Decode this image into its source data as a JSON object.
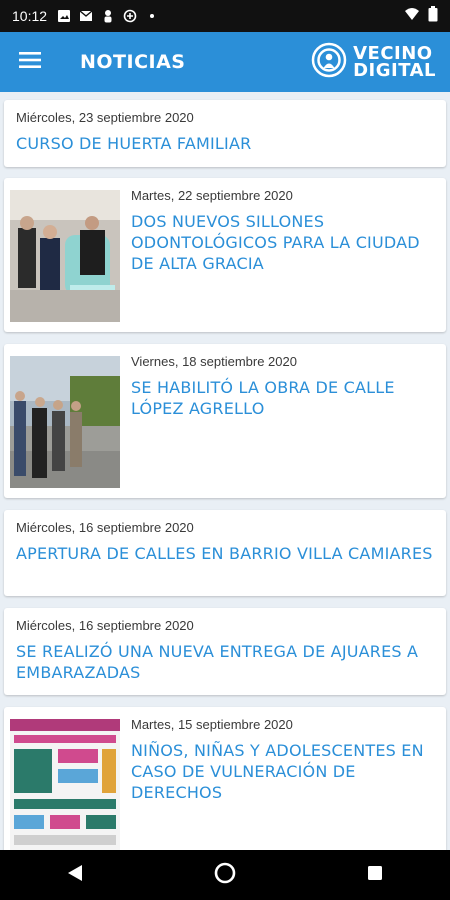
{
  "status_bar": {
    "time": "10:12"
  },
  "app_bar": {
    "title": "NOTICIAS",
    "brand_line1": "VECINO",
    "brand_line2": "DIGITAL"
  },
  "news": [
    {
      "date": "Miércoles, 23 septiembre 2020",
      "title": "CURSO DE HUERTA FAMILIAR"
    },
    {
      "date": "Martes, 22 septiembre 2020",
      "title": "DOS NUEVOS SILLONES ODONTOLÓGICOS PARA LA CIUDAD DE ALTA GRACIA"
    },
    {
      "date": "Viernes, 18 septiembre 2020",
      "title": "SE HABILITÓ LA OBRA DE CALLE LÓPEZ AGRELLO"
    },
    {
      "date": "Miércoles, 16 septiembre 2020",
      "title": "APERTURA DE CALLES EN BARRIO VILLA CAMIARES"
    },
    {
      "date": "Miércoles, 16 septiembre 2020",
      "title": "SE REALIZÓ UNA NUEVA ENTREGA DE AJUARES A EMBARAZADAS"
    },
    {
      "date": "Martes, 15 septiembre 2020",
      "title": "NIÑOS, NIÑAS Y ADOLESCENTES EN CASO DE VULNERACIÓN DE DERECHOS"
    }
  ],
  "icons": {
    "menu": "hamburger-menu-icon",
    "brand": "vecino-digital-logo-icon",
    "back": "back-triangle-icon",
    "home": "home-circle-icon",
    "recents": "recents-square-icon"
  },
  "colors": {
    "primary": "#2b8fd8",
    "background": "#e9eff5"
  }
}
